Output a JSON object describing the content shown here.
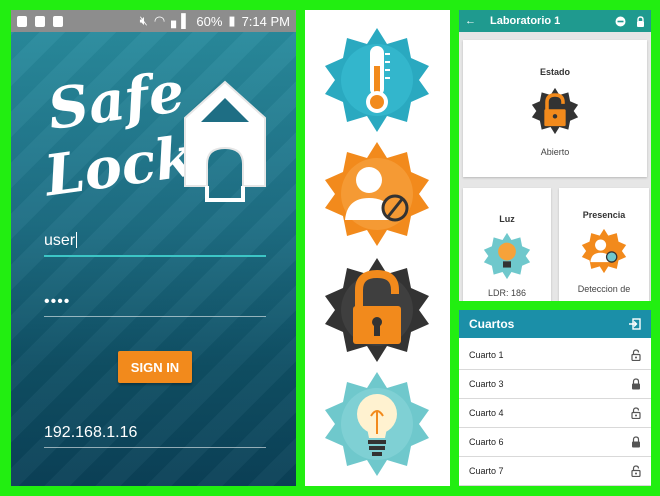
{
  "login": {
    "status": {
      "battery": "60%",
      "time": "7:14 PM"
    },
    "logo_line1": "Safe",
    "logo_line2": "Lock",
    "username": "user",
    "password_mask": "••••",
    "signin_label": "SIGN IN",
    "server_ip": "192.168.1.16",
    "colors": {
      "accent": "#f28a1c",
      "underline": "#3cc6c6"
    }
  },
  "icons": [
    {
      "name": "thermometer-icon",
      "color": "#2aa9c0"
    },
    {
      "name": "presence-icon",
      "color": "#f28a1c"
    },
    {
      "name": "padlock-open-icon",
      "color": "#3a3a3a"
    },
    {
      "name": "lightbulb-icon",
      "color": "#6fc8cc"
    }
  ],
  "lab": {
    "title": "Laboratorio 1",
    "estado": {
      "heading": "Estado",
      "value": "Abierto"
    },
    "luz": {
      "heading": "Luz",
      "value": "LDR: 186"
    },
    "presencia": {
      "heading": "Presencia",
      "value": "Deteccion de"
    },
    "colors": {
      "appbar": "#1f9a8f"
    }
  },
  "rooms": {
    "title": "Cuartos",
    "items": [
      {
        "label": "Cuarto 1",
        "locked": false
      },
      {
        "label": "Cuarto 3",
        "locked": true
      },
      {
        "label": "Cuarto 4",
        "locked": false
      },
      {
        "label": "Cuarto 6",
        "locked": true
      },
      {
        "label": "Cuarto 7",
        "locked": false
      }
    ],
    "colors": {
      "bar": "#1b8fa8"
    }
  }
}
